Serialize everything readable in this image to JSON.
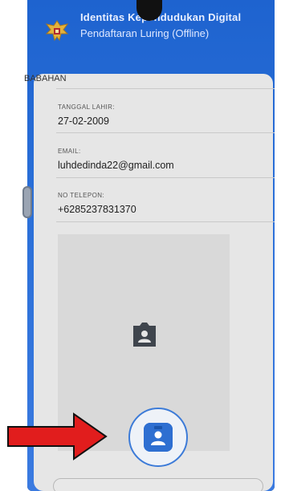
{
  "header": {
    "title": "Identitas Kependudukan Digital",
    "subtitle": "Pendaftaran Luring (Offline)"
  },
  "form": {
    "prev_value": "BABAHAN",
    "fields": [
      {
        "label": "TANGGAL LAHIR:",
        "value": "27-02-2009"
      },
      {
        "label": "EMAIL:",
        "value": "luhdedinda22@gmail.com"
      },
      {
        "label": "NO TELEPON:",
        "value": "+6285237831370"
      }
    ]
  },
  "colors": {
    "header_blue": "#1e63cf",
    "accent_blue": "#2e6fd1",
    "arrow_red": "#e11d1d"
  },
  "icons": [
    "garuda-emblem-icon",
    "camera-icon",
    "arrow-right-icon"
  ]
}
